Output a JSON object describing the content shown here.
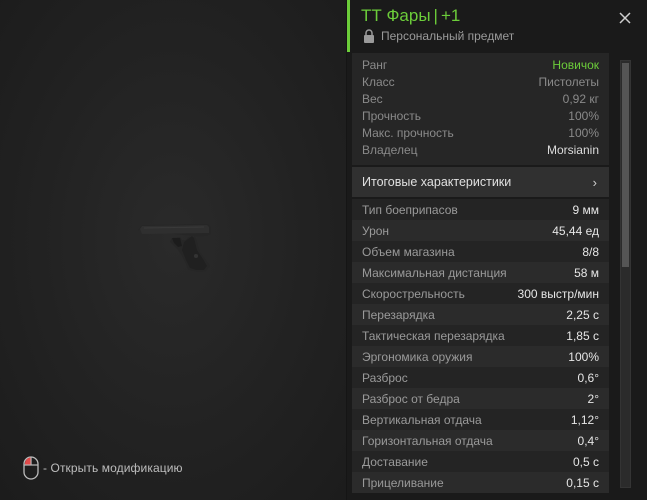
{
  "item": {
    "name": "ТТ Фары",
    "separator": "|",
    "upgrade": "+1",
    "subtitle": "Персональный предмет"
  },
  "info": [
    {
      "label": "Ранг",
      "value": "Новичок"
    },
    {
      "label": "Класс",
      "value": "Пистолеты"
    },
    {
      "label": "Вес",
      "value": "0,92 кг"
    },
    {
      "label": "Прочность",
      "value": "100%"
    },
    {
      "label": "Макс. прочность",
      "value": "100%"
    },
    {
      "label": "Владелец",
      "value": "Morsianin"
    }
  ],
  "summary": {
    "label": "Итоговые характеристики",
    "chevron": "›"
  },
  "stats": [
    {
      "label": "Тип боеприпасов",
      "value": "9 мм"
    },
    {
      "label": "Урон",
      "value": "45,44 ед"
    },
    {
      "label": "Объем магазина",
      "value": "8/8"
    },
    {
      "label": "Максимальная дистанция",
      "value": "58 м"
    },
    {
      "label": "Скорострельность",
      "value": "300 выстр/мин"
    },
    {
      "label": "Перезарядка",
      "value": "2,25 с"
    },
    {
      "label": "Тактическая перезарядка",
      "value": "1,85 с"
    },
    {
      "label": "Эргономика оружия",
      "value": "100%"
    },
    {
      "label": "Разброс",
      "value": "0,6°"
    },
    {
      "label": "Разброс от бедра",
      "value": "2°"
    },
    {
      "label": "Вертикальная отдача",
      "value": "1,12°"
    },
    {
      "label": "Горизонтальная отдача",
      "value": "0,4°"
    },
    {
      "label": "Доставание",
      "value": "0,5 с"
    },
    {
      "label": "Прицеливание",
      "value": "0,15 с"
    }
  ],
  "hint": {
    "text": "- Открыть модификацию",
    "icon": "mouse-icon"
  },
  "colors": {
    "accent": "#6ccd3a",
    "background": "#1e1e1e"
  }
}
